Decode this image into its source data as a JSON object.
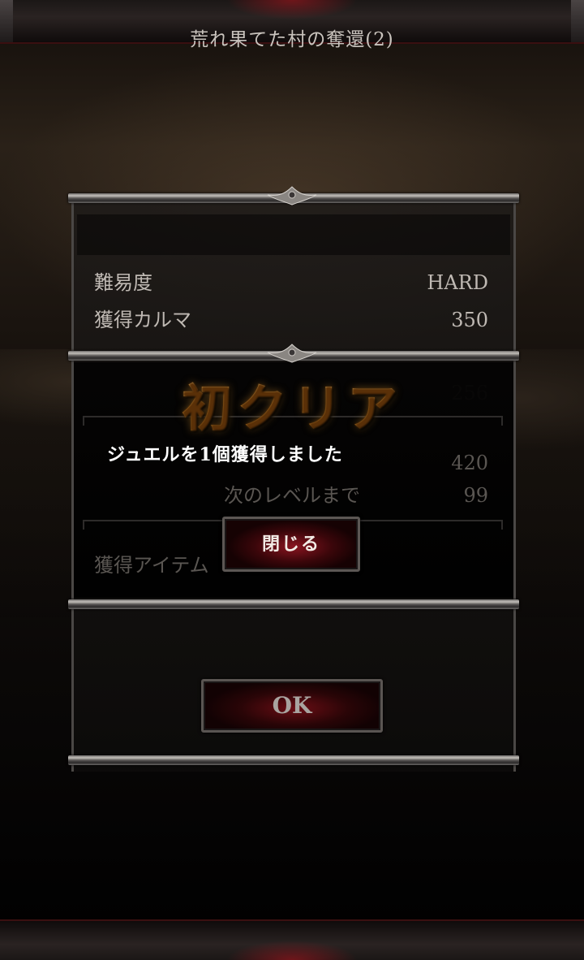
{
  "result": {
    "title": "荒れ果てた村の奪還(2)",
    "rows": [
      {
        "label": "難易度",
        "value": "HARD"
      },
      {
        "label": "獲得カルマ",
        "value": "350"
      }
    ],
    "hidden_rows": [
      {
        "label": "",
        "value": "256"
      },
      {
        "label": "",
        "value": "420"
      },
      {
        "label": "次のレベルまで",
        "value": "99"
      },
      {
        "label": "獲得アイテム",
        "value": ""
      }
    ],
    "ok_label": "OK"
  },
  "dialog": {
    "title": "初クリア",
    "message": "ジュエルを1個獲得しました",
    "close_label": "閉じる"
  },
  "colors": {
    "accent_gold": "#d9a24a",
    "button_red": "#8a1420",
    "frame_silver": "#c4c0bb"
  }
}
